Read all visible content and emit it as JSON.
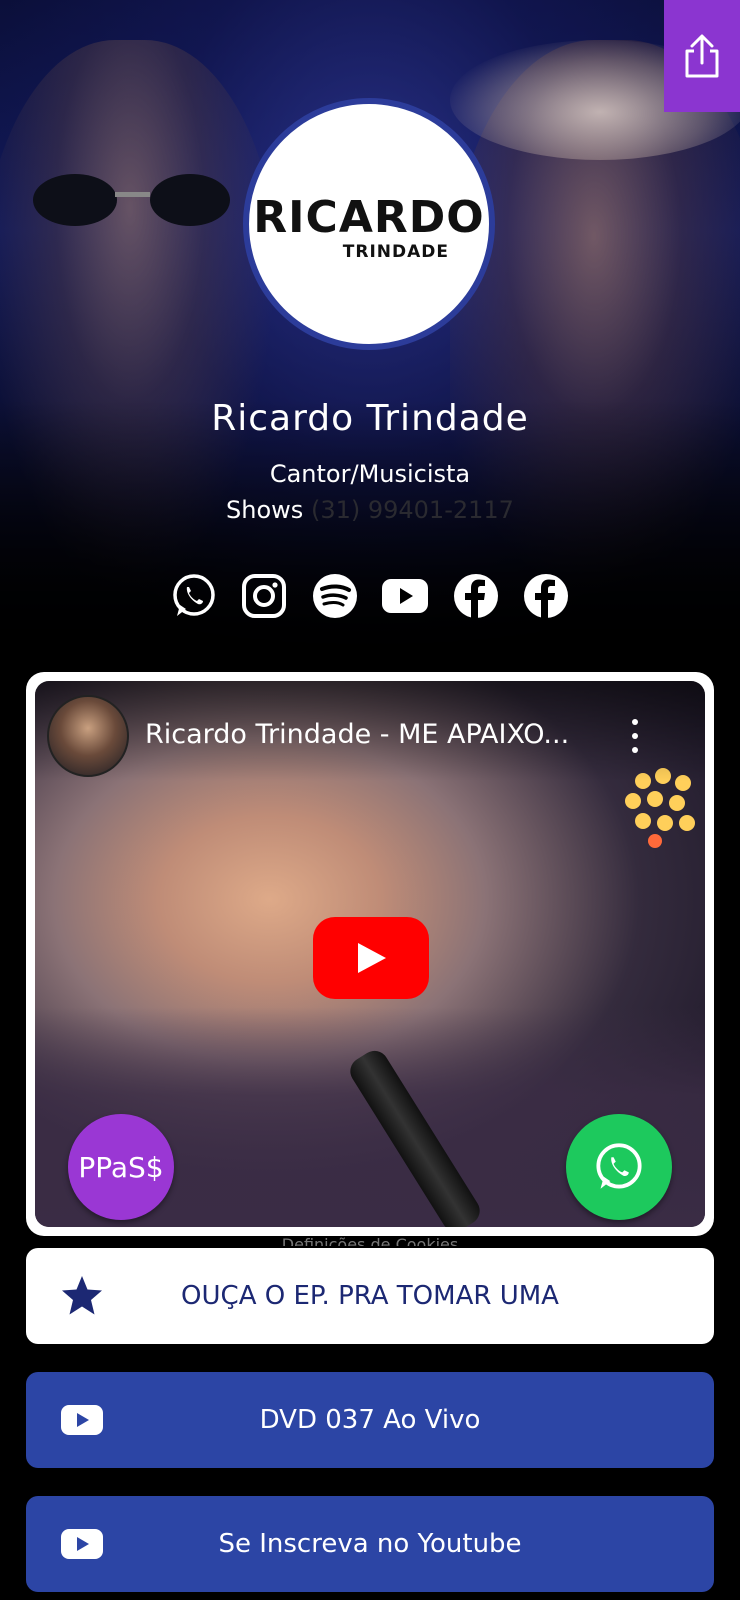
{
  "profile": {
    "logo_main": "RICARDO",
    "logo_sub": "TRINDADE",
    "name": "Ricardo Trindade",
    "role": "Cantor/Musicista",
    "shows_label": "Shows",
    "shows_phone": "(31) 99401-2117"
  },
  "socials": [
    {
      "icon": "whatsapp-icon"
    },
    {
      "icon": "instagram-icon"
    },
    {
      "icon": "spotify-icon"
    },
    {
      "icon": "youtube-icon"
    },
    {
      "icon": "facebook-icon"
    },
    {
      "icon": "facebook-icon"
    }
  ],
  "video": {
    "title": "Ricardo Trindade - ME APAIXO..."
  },
  "fabs": {
    "ppass_label": "PPaS$"
  },
  "peek_text": "Definições de Cookies",
  "links": [
    {
      "label": "OUÇA O EP. PRA TOMAR UMA",
      "icon": "star-icon"
    },
    {
      "label": "DVD 037 Ao Vivo",
      "icon": "youtube-icon"
    },
    {
      "label": "Se Inscreva no Youtube",
      "icon": "youtube-icon"
    }
  ],
  "colors": {
    "share_button": "#8b35d0",
    "link_blue": "#2c45a5",
    "link_white_text": "#1c2873",
    "ppass": "#9a37d4",
    "whatsapp": "#1dc95d",
    "youtube_red": "#ff0000"
  }
}
